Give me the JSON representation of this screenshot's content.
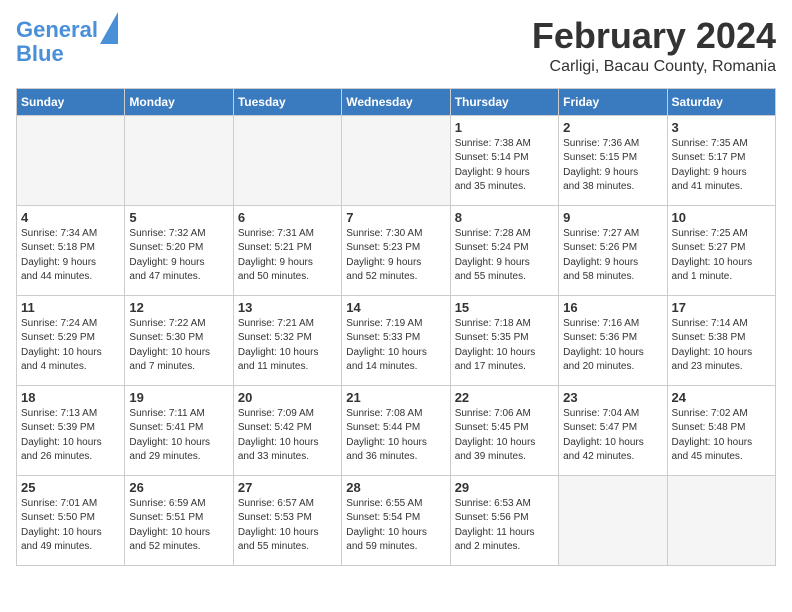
{
  "header": {
    "logo_line1": "General",
    "logo_line2": "Blue",
    "main_title": "February 2024",
    "subtitle": "Carligi, Bacau County, Romania"
  },
  "days_of_week": [
    "Sunday",
    "Monday",
    "Tuesday",
    "Wednesday",
    "Thursday",
    "Friday",
    "Saturday"
  ],
  "weeks": [
    [
      {
        "day": "",
        "detail": ""
      },
      {
        "day": "",
        "detail": ""
      },
      {
        "day": "",
        "detail": ""
      },
      {
        "day": "",
        "detail": ""
      },
      {
        "day": "1",
        "detail": "Sunrise: 7:38 AM\nSunset: 5:14 PM\nDaylight: 9 hours\nand 35 minutes."
      },
      {
        "day": "2",
        "detail": "Sunrise: 7:36 AM\nSunset: 5:15 PM\nDaylight: 9 hours\nand 38 minutes."
      },
      {
        "day": "3",
        "detail": "Sunrise: 7:35 AM\nSunset: 5:17 PM\nDaylight: 9 hours\nand 41 minutes."
      }
    ],
    [
      {
        "day": "4",
        "detail": "Sunrise: 7:34 AM\nSunset: 5:18 PM\nDaylight: 9 hours\nand 44 minutes."
      },
      {
        "day": "5",
        "detail": "Sunrise: 7:32 AM\nSunset: 5:20 PM\nDaylight: 9 hours\nand 47 minutes."
      },
      {
        "day": "6",
        "detail": "Sunrise: 7:31 AM\nSunset: 5:21 PM\nDaylight: 9 hours\nand 50 minutes."
      },
      {
        "day": "7",
        "detail": "Sunrise: 7:30 AM\nSunset: 5:23 PM\nDaylight: 9 hours\nand 52 minutes."
      },
      {
        "day": "8",
        "detail": "Sunrise: 7:28 AM\nSunset: 5:24 PM\nDaylight: 9 hours\nand 55 minutes."
      },
      {
        "day": "9",
        "detail": "Sunrise: 7:27 AM\nSunset: 5:26 PM\nDaylight: 9 hours\nand 58 minutes."
      },
      {
        "day": "10",
        "detail": "Sunrise: 7:25 AM\nSunset: 5:27 PM\nDaylight: 10 hours\nand 1 minute."
      }
    ],
    [
      {
        "day": "11",
        "detail": "Sunrise: 7:24 AM\nSunset: 5:29 PM\nDaylight: 10 hours\nand 4 minutes."
      },
      {
        "day": "12",
        "detail": "Sunrise: 7:22 AM\nSunset: 5:30 PM\nDaylight: 10 hours\nand 7 minutes."
      },
      {
        "day": "13",
        "detail": "Sunrise: 7:21 AM\nSunset: 5:32 PM\nDaylight: 10 hours\nand 11 minutes."
      },
      {
        "day": "14",
        "detail": "Sunrise: 7:19 AM\nSunset: 5:33 PM\nDaylight: 10 hours\nand 14 minutes."
      },
      {
        "day": "15",
        "detail": "Sunrise: 7:18 AM\nSunset: 5:35 PM\nDaylight: 10 hours\nand 17 minutes."
      },
      {
        "day": "16",
        "detail": "Sunrise: 7:16 AM\nSunset: 5:36 PM\nDaylight: 10 hours\nand 20 minutes."
      },
      {
        "day": "17",
        "detail": "Sunrise: 7:14 AM\nSunset: 5:38 PM\nDaylight: 10 hours\nand 23 minutes."
      }
    ],
    [
      {
        "day": "18",
        "detail": "Sunrise: 7:13 AM\nSunset: 5:39 PM\nDaylight: 10 hours\nand 26 minutes."
      },
      {
        "day": "19",
        "detail": "Sunrise: 7:11 AM\nSunset: 5:41 PM\nDaylight: 10 hours\nand 29 minutes."
      },
      {
        "day": "20",
        "detail": "Sunrise: 7:09 AM\nSunset: 5:42 PM\nDaylight: 10 hours\nand 33 minutes."
      },
      {
        "day": "21",
        "detail": "Sunrise: 7:08 AM\nSunset: 5:44 PM\nDaylight: 10 hours\nand 36 minutes."
      },
      {
        "day": "22",
        "detail": "Sunrise: 7:06 AM\nSunset: 5:45 PM\nDaylight: 10 hours\nand 39 minutes."
      },
      {
        "day": "23",
        "detail": "Sunrise: 7:04 AM\nSunset: 5:47 PM\nDaylight: 10 hours\nand 42 minutes."
      },
      {
        "day": "24",
        "detail": "Sunrise: 7:02 AM\nSunset: 5:48 PM\nDaylight: 10 hours\nand 45 minutes."
      }
    ],
    [
      {
        "day": "25",
        "detail": "Sunrise: 7:01 AM\nSunset: 5:50 PM\nDaylight: 10 hours\nand 49 minutes."
      },
      {
        "day": "26",
        "detail": "Sunrise: 6:59 AM\nSunset: 5:51 PM\nDaylight: 10 hours\nand 52 minutes."
      },
      {
        "day": "27",
        "detail": "Sunrise: 6:57 AM\nSunset: 5:53 PM\nDaylight: 10 hours\nand 55 minutes."
      },
      {
        "day": "28",
        "detail": "Sunrise: 6:55 AM\nSunset: 5:54 PM\nDaylight: 10 hours\nand 59 minutes."
      },
      {
        "day": "29",
        "detail": "Sunrise: 6:53 AM\nSunset: 5:56 PM\nDaylight: 11 hours\nand 2 minutes."
      },
      {
        "day": "",
        "detail": ""
      },
      {
        "day": "",
        "detail": ""
      }
    ]
  ]
}
